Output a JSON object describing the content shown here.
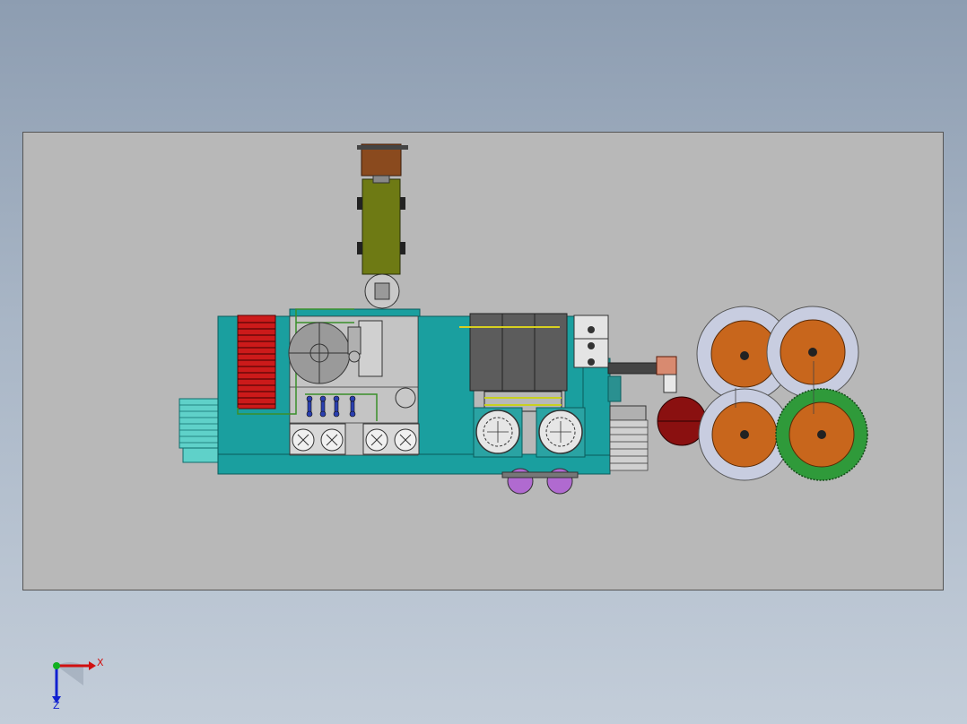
{
  "view": {
    "background_top": "#8d9db1",
    "background_bottom": "#c3cdd9",
    "sheet_color": "#b8b8b8"
  },
  "triad": {
    "x_label": "X",
    "z_label": "Z",
    "x_color": "#d01010",
    "y_color": "#10b020",
    "z_color": "#1020d0"
  },
  "model": {
    "frame_color": "#1a9f9f",
    "drum_color": "#c8661c",
    "drum_rim_color": "#c8cde0",
    "gear_color": "#2f9a3a",
    "heater_color": "#cc1a1a",
    "tank_color": "#8a1010",
    "trailer_color": "#6e7a14",
    "cab_color": "#8a4a1e",
    "cabinet_color": "#5c5c5c",
    "pump_color": "#b06ad0"
  }
}
